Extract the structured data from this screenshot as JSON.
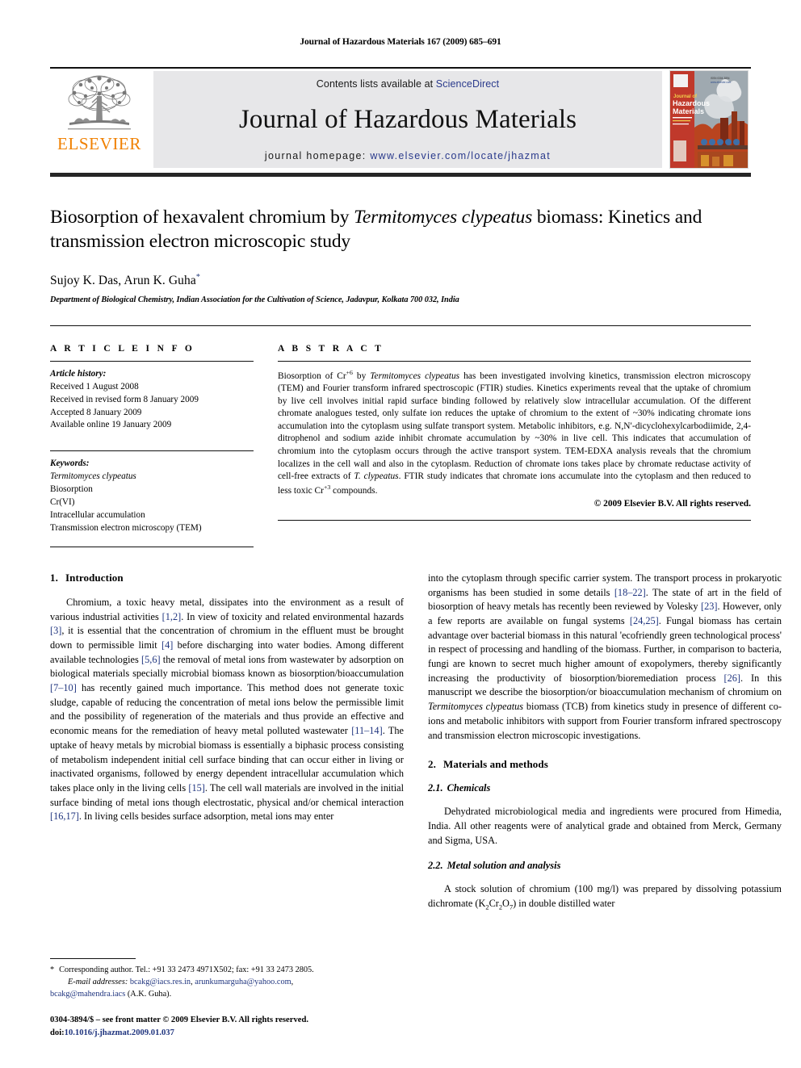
{
  "running_head": "Journal of Hazardous Materials 167 (2009) 685–691",
  "masthead": {
    "contents_prefix": "Contents lists available at ",
    "sciencedirect": "ScienceDirect",
    "journal_name": "Journal of Hazardous Materials",
    "homepage_prefix": "journal homepage: ",
    "homepage_url": "www.elsevier.com/locate/jhazmat",
    "publisher": "ELSEVIER",
    "cover_title_top": "Journal of",
    "cover_title_main1": "Hazardous",
    "cover_title_main2": "Materials",
    "accent_color": "#F08000",
    "link_color": "#2a3a8c",
    "panel_color": "#e7e7e9"
  },
  "article": {
    "title_part1": "Biosorption of hexavalent chromium by ",
    "title_italic": "Termitomyces clypeatus",
    "title_part2": " biomass: Kinetics and transmission electron microscopic study",
    "authors": "Sujoy K. Das, Arun K. Guha",
    "author_marker": "*",
    "affiliation": "Department of Biological Chemistry, Indian Association for the Cultivation of Science, Jadavpur, Kolkata 700 032, India"
  },
  "article_info": {
    "heading": "A R T I C L E   I N F O",
    "history_label": "Article history:",
    "history": [
      "Received 1 August 2008",
      "Received in revised form 8 January 2009",
      "Accepted 8 January 2009",
      "Available online 19 January 2009"
    ],
    "keywords_label": "Keywords:",
    "keywords": [
      "Termitomyces clypeatus",
      "Biosorption",
      "Cr(VI)",
      "Intracellular accumulation",
      "Transmission electron microscopy (TEM)"
    ]
  },
  "abstract": {
    "heading": "A B S T R A C T",
    "seg1": "Biosorption of Cr",
    "seg1_sup": "+6",
    "seg2": " by ",
    "seg2_italic": "Termitomyces clypeatus",
    "seg3": " has been investigated involving kinetics, transmission electron microscopy (TEM) and Fourier transform infrared spectroscopic (FTIR) studies. Kinetics experiments reveal that the uptake of chromium by live cell involves initial rapid surface binding followed by relatively slow intracellular accumulation. Of the different chromate analogues tested, only sulfate ion reduces the uptake of chromium to the extent of ~30% indicating chromate ions accumulation into the cytoplasm using sulfate transport system. Metabolic inhibitors, e.g. N,N′-dicyclohexylcarbodiimide, 2,4-ditrophenol and sodium azide inhibit chromate accumulation by ~30% in live cell. This indicates that accumulation of chromium into the cytoplasm occurs through the active transport system. TEM-EDXA analysis reveals that the chromium localizes in the cell wall and also in the cytoplasm. Reduction of chromate ions takes place by chromate reductase activity of cell-free extracts of ",
    "seg4_italic": "T. clypeatus",
    "seg5": ". FTIR study indicates that chromate ions accumulate into the cytoplasm and then reduced to less toxic Cr",
    "seg5_sup": "+3",
    "seg6": " compounds.",
    "copyright": "© 2009 Elsevier B.V. All rights reserved."
  },
  "sections": {
    "intro_num": "1.",
    "intro_title": "Introduction",
    "intro_p1_a": "Chromium, a toxic heavy metal, dissipates into the environment as a result of various industrial activities ",
    "intro_r1": "[1,2]",
    "intro_p1_b": ". In view of toxicity and related environmental hazards ",
    "intro_r2": "[3]",
    "intro_p1_c": ", it is essential that the concentration of chromium in the effluent must be brought down to permissible limit ",
    "intro_r3": "[4]",
    "intro_p1_d": " before discharging into water bodies. Among different available technologies ",
    "intro_r4": "[5,6]",
    "intro_p1_e": " the removal of metal ions from wastewater by adsorption on biological materials specially microbial biomass known as biosorption/bioaccumulation ",
    "intro_r5": "[7–10]",
    "intro_p1_f": " has recently gained much importance. This method does not generate toxic sludge, capable of reducing the concentration of metal ions below the permissible limit and the possibility of regeneration of the materials and thus provide an effective and economic means for the remediation of heavy metal polluted wastewater ",
    "intro_r6": "[11–14]",
    "intro_p1_g": ". The uptake of heavy metals by microbial biomass is essentially a biphasic process consisting of metabolism independent initial cell surface binding that can occur either in living or inactivated organisms, followed by energy dependent intracellular accumulation which takes place only in the living cells ",
    "intro_r7": "[15]",
    "intro_p1_h": ". The cell wall materials are involved in the initial surface binding of metal ions though electrostatic, physical and/or chemical interaction ",
    "intro_r8": "[16,17]",
    "intro_p1_i": ". In living cells besides surface adsorption, metal ions may enter into the cytoplasm through specific carrier system. The transport process in prokaryotic organisms has been studied in some details ",
    "intro_r9": "[18–22]",
    "intro_p1_j": ". The state of art in the field of biosorption of heavy metals has recently been reviewed by Volesky ",
    "intro_r10": "[23]",
    "intro_p1_k": ". However, only a few reports are available on fungal systems ",
    "intro_r11": "[24,25]",
    "intro_p1_l": ". Fungal biomass has certain advantage over bacterial biomass in this natural 'ecofriendly green technological process' in respect of processing and handling of the biomass. Further, in comparison to bacteria, fungi are known to secret much higher amount of exopolymers, thereby significantly increasing the productivity of biosorption/bioremediation process ",
    "intro_r12": "[26]",
    "intro_p1_m": ". In this manuscript we describe the biosorption/or bioaccumulation mechanism of chromium on ",
    "intro_sp1": "Termitomyces clypeatus",
    "intro_p1_n": " biomass (TCB) from kinetics study in presence of different co-ions and metabolic inhibitors with support from Fourier transform infrared spectroscopy and transmission electron microscopic investigations.",
    "mat_num": "2.",
    "mat_title": "Materials and methods",
    "chem_num": "2.1.",
    "chem_title": "Chemicals",
    "chem_p": "Dehydrated microbiological media and ingredients were procured from Himedia, India. All other reagents were of analytical grade and obtained from Merck, Germany and Sigma, USA.",
    "metal_num": "2.2.",
    "metal_title": "Metal solution and analysis",
    "metal_p_a": "A stock solution of chromium (100 mg/l) was prepared by dissolving potassium dichromate (K",
    "metal_sub1": "2",
    "metal_p_b": "Cr",
    "metal_sub2": "2",
    "metal_p_c": "O",
    "metal_sub3": "7",
    "metal_p_d": ") in double distilled water"
  },
  "footnote": {
    "star": "*",
    "corr_text": "Corresponding author. Tel.: +91 33 2473 4971X502; fax: +91 33 2473 2805.",
    "email_label": "E-mail addresses:",
    "email1": "bcakg@iacs.res.in",
    "email_sep1": ", ",
    "email2": "arunkumarguha@yahoo.com",
    "email_sep2": ", ",
    "email3": "bcakg@mahendra.iacs",
    "email_owner": " (A.K. Guha).",
    "imprint": "0304-3894/$ – see front matter © 2009 Elsevier B.V. All rights reserved.",
    "doi_label": "doi:",
    "doi_value": "10.1016/j.jhazmat.2009.01.037"
  }
}
